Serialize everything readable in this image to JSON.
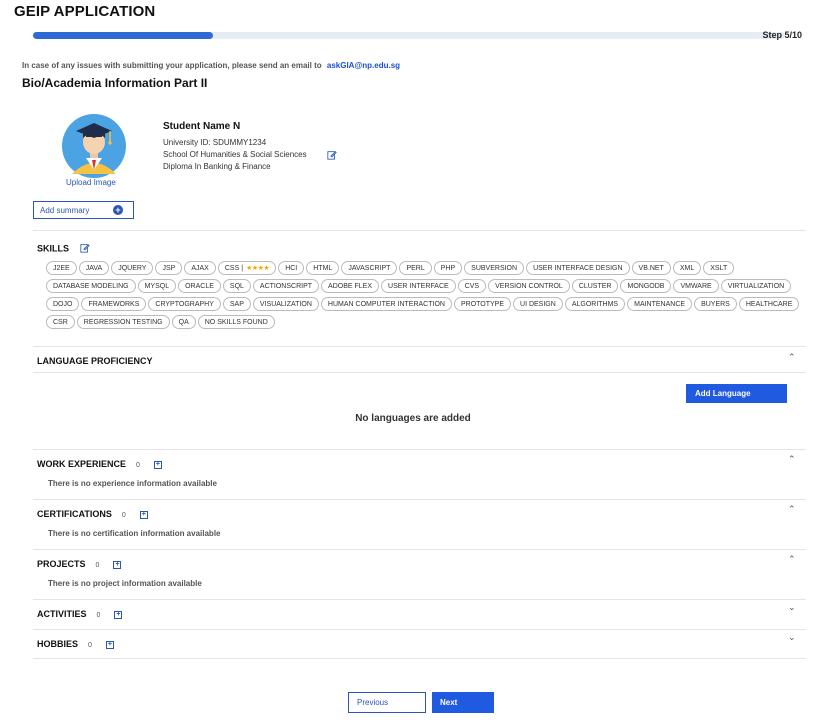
{
  "header": {
    "title": "GEIP APPLICATION",
    "step": "Step 5/10",
    "progress_fraction": 0.24
  },
  "notice": {
    "text": "In case of any issues with submitting your application, please send an email to",
    "email": "askGIA@np.edu.sg"
  },
  "section_title": "Bio/Academia Information Part II",
  "profile": {
    "name": "Student Name N",
    "university_id": "University ID: SDUMMY1234",
    "school": "School Of Humanities & Social Sciences",
    "diploma": "Diploma In Banking & Finance",
    "upload_label": "Upload Image",
    "add_summary_label": "Add summary"
  },
  "skills": {
    "label": "SKILLS",
    "items": [
      "J2EE",
      "JAVA",
      "JQUERY",
      "JSP",
      "AJAX",
      "CSS",
      "HCI",
      "HTML",
      "JAVASCRIPT",
      "PERL",
      "PHP",
      "SUBVERSION",
      "USER INTERFACE DESIGN",
      "VB.NET",
      "XML",
      "XSLT",
      "DATABASE MODELING",
      "MYSQL",
      "ORACLE",
      "SQL",
      "ACTIONSCRIPT",
      "ADOBE FLEX",
      "USER INTERFACE",
      "CVS",
      "VERSION CONTROL",
      "CLUSTER",
      "MONGODB",
      "VMWARE",
      "VIRTUALIZATION",
      "DOJO",
      "FRAMEWORKS",
      "CRYPTOGRAPHY",
      "SAP",
      "VISUALIZATION",
      "HUMAN COMPUTER INTERACTION",
      "PROTOTYPE",
      "UI DESIGN",
      "ALGORITHMS",
      "MAINTENANCE",
      "BUYERS",
      "HEALTHCARE",
      "CSR",
      "REGRESSION TESTING",
      "QA",
      "NO SKILLS FOUND"
    ],
    "css_stars": "★★★★",
    "css_rating": 4
  },
  "language": {
    "heading": "LANGUAGE PROFICIENCY",
    "add_label": "Add Language",
    "empty": "No languages are added"
  },
  "sections": {
    "work": {
      "heading": "WORK EXPERIENCE",
      "count": "0",
      "empty": "There is no experience information available"
    },
    "certifications": {
      "heading": "CERTIFICATIONS",
      "count": "0",
      "empty": "There is no certification information available"
    },
    "projects": {
      "heading": "PROJECTS",
      "count": "0",
      "empty": "There is no project information available"
    },
    "activities": {
      "heading": "ACTIVITIES",
      "count": "0"
    },
    "hobbies": {
      "heading": "HOBBIES",
      "count": "0"
    }
  },
  "nav": {
    "previous": "Previous",
    "next": "Next"
  },
  "colors": {
    "primary": "#1f5ae0",
    "progress": "#2d6ad6",
    "star": "#f2a900"
  }
}
